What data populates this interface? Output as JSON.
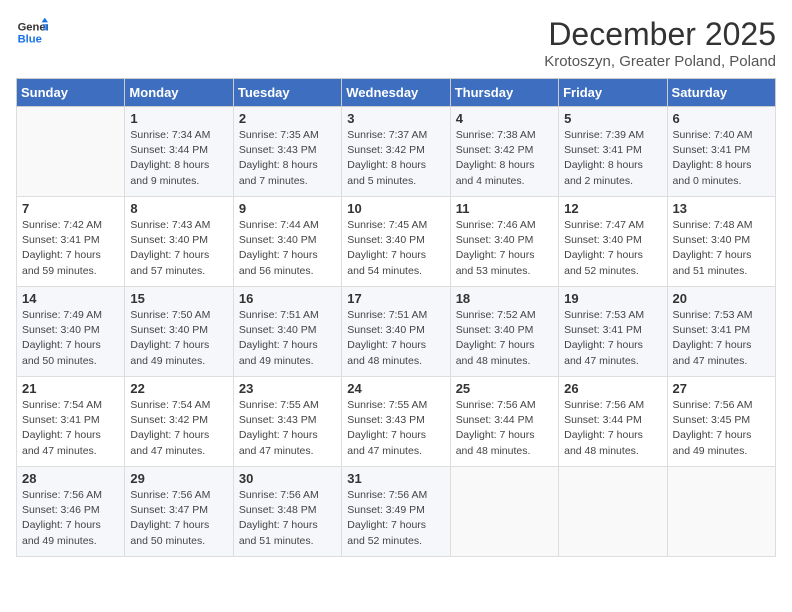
{
  "logo": {
    "line1": "General",
    "line2": "Blue"
  },
  "title": "December 2025",
  "location": "Krotoszyn, Greater Poland, Poland",
  "days_of_week": [
    "Sunday",
    "Monday",
    "Tuesday",
    "Wednesday",
    "Thursday",
    "Friday",
    "Saturday"
  ],
  "weeks": [
    [
      {
        "num": "",
        "sunrise": "",
        "sunset": "",
        "daylight": ""
      },
      {
        "num": "1",
        "sunrise": "Sunrise: 7:34 AM",
        "sunset": "Sunset: 3:44 PM",
        "daylight": "Daylight: 8 hours and 9 minutes."
      },
      {
        "num": "2",
        "sunrise": "Sunrise: 7:35 AM",
        "sunset": "Sunset: 3:43 PM",
        "daylight": "Daylight: 8 hours and 7 minutes."
      },
      {
        "num": "3",
        "sunrise": "Sunrise: 7:37 AM",
        "sunset": "Sunset: 3:42 PM",
        "daylight": "Daylight: 8 hours and 5 minutes."
      },
      {
        "num": "4",
        "sunrise": "Sunrise: 7:38 AM",
        "sunset": "Sunset: 3:42 PM",
        "daylight": "Daylight: 8 hours and 4 minutes."
      },
      {
        "num": "5",
        "sunrise": "Sunrise: 7:39 AM",
        "sunset": "Sunset: 3:41 PM",
        "daylight": "Daylight: 8 hours and 2 minutes."
      },
      {
        "num": "6",
        "sunrise": "Sunrise: 7:40 AM",
        "sunset": "Sunset: 3:41 PM",
        "daylight": "Daylight: 8 hours and 0 minutes."
      }
    ],
    [
      {
        "num": "7",
        "sunrise": "Sunrise: 7:42 AM",
        "sunset": "Sunset: 3:41 PM",
        "daylight": "Daylight: 7 hours and 59 minutes."
      },
      {
        "num": "8",
        "sunrise": "Sunrise: 7:43 AM",
        "sunset": "Sunset: 3:40 PM",
        "daylight": "Daylight: 7 hours and 57 minutes."
      },
      {
        "num": "9",
        "sunrise": "Sunrise: 7:44 AM",
        "sunset": "Sunset: 3:40 PM",
        "daylight": "Daylight: 7 hours and 56 minutes."
      },
      {
        "num": "10",
        "sunrise": "Sunrise: 7:45 AM",
        "sunset": "Sunset: 3:40 PM",
        "daylight": "Daylight: 7 hours and 54 minutes."
      },
      {
        "num": "11",
        "sunrise": "Sunrise: 7:46 AM",
        "sunset": "Sunset: 3:40 PM",
        "daylight": "Daylight: 7 hours and 53 minutes."
      },
      {
        "num": "12",
        "sunrise": "Sunrise: 7:47 AM",
        "sunset": "Sunset: 3:40 PM",
        "daylight": "Daylight: 7 hours and 52 minutes."
      },
      {
        "num": "13",
        "sunrise": "Sunrise: 7:48 AM",
        "sunset": "Sunset: 3:40 PM",
        "daylight": "Daylight: 7 hours and 51 minutes."
      }
    ],
    [
      {
        "num": "14",
        "sunrise": "Sunrise: 7:49 AM",
        "sunset": "Sunset: 3:40 PM",
        "daylight": "Daylight: 7 hours and 50 minutes."
      },
      {
        "num": "15",
        "sunrise": "Sunrise: 7:50 AM",
        "sunset": "Sunset: 3:40 PM",
        "daylight": "Daylight: 7 hours and 49 minutes."
      },
      {
        "num": "16",
        "sunrise": "Sunrise: 7:51 AM",
        "sunset": "Sunset: 3:40 PM",
        "daylight": "Daylight: 7 hours and 49 minutes."
      },
      {
        "num": "17",
        "sunrise": "Sunrise: 7:51 AM",
        "sunset": "Sunset: 3:40 PM",
        "daylight": "Daylight: 7 hours and 48 minutes."
      },
      {
        "num": "18",
        "sunrise": "Sunrise: 7:52 AM",
        "sunset": "Sunset: 3:40 PM",
        "daylight": "Daylight: 7 hours and 48 minutes."
      },
      {
        "num": "19",
        "sunrise": "Sunrise: 7:53 AM",
        "sunset": "Sunset: 3:41 PM",
        "daylight": "Daylight: 7 hours and 47 minutes."
      },
      {
        "num": "20",
        "sunrise": "Sunrise: 7:53 AM",
        "sunset": "Sunset: 3:41 PM",
        "daylight": "Daylight: 7 hours and 47 minutes."
      }
    ],
    [
      {
        "num": "21",
        "sunrise": "Sunrise: 7:54 AM",
        "sunset": "Sunset: 3:41 PM",
        "daylight": "Daylight: 7 hours and 47 minutes."
      },
      {
        "num": "22",
        "sunrise": "Sunrise: 7:54 AM",
        "sunset": "Sunset: 3:42 PM",
        "daylight": "Daylight: 7 hours and 47 minutes."
      },
      {
        "num": "23",
        "sunrise": "Sunrise: 7:55 AM",
        "sunset": "Sunset: 3:43 PM",
        "daylight": "Daylight: 7 hours and 47 minutes."
      },
      {
        "num": "24",
        "sunrise": "Sunrise: 7:55 AM",
        "sunset": "Sunset: 3:43 PM",
        "daylight": "Daylight: 7 hours and 47 minutes."
      },
      {
        "num": "25",
        "sunrise": "Sunrise: 7:56 AM",
        "sunset": "Sunset: 3:44 PM",
        "daylight": "Daylight: 7 hours and 48 minutes."
      },
      {
        "num": "26",
        "sunrise": "Sunrise: 7:56 AM",
        "sunset": "Sunset: 3:44 PM",
        "daylight": "Daylight: 7 hours and 48 minutes."
      },
      {
        "num": "27",
        "sunrise": "Sunrise: 7:56 AM",
        "sunset": "Sunset: 3:45 PM",
        "daylight": "Daylight: 7 hours and 49 minutes."
      }
    ],
    [
      {
        "num": "28",
        "sunrise": "Sunrise: 7:56 AM",
        "sunset": "Sunset: 3:46 PM",
        "daylight": "Daylight: 7 hours and 49 minutes."
      },
      {
        "num": "29",
        "sunrise": "Sunrise: 7:56 AM",
        "sunset": "Sunset: 3:47 PM",
        "daylight": "Daylight: 7 hours and 50 minutes."
      },
      {
        "num": "30",
        "sunrise": "Sunrise: 7:56 AM",
        "sunset": "Sunset: 3:48 PM",
        "daylight": "Daylight: 7 hours and 51 minutes."
      },
      {
        "num": "31",
        "sunrise": "Sunrise: 7:56 AM",
        "sunset": "Sunset: 3:49 PM",
        "daylight": "Daylight: 7 hours and 52 minutes."
      },
      {
        "num": "",
        "sunrise": "",
        "sunset": "",
        "daylight": ""
      },
      {
        "num": "",
        "sunrise": "",
        "sunset": "",
        "daylight": ""
      },
      {
        "num": "",
        "sunrise": "",
        "sunset": "",
        "daylight": ""
      }
    ]
  ]
}
